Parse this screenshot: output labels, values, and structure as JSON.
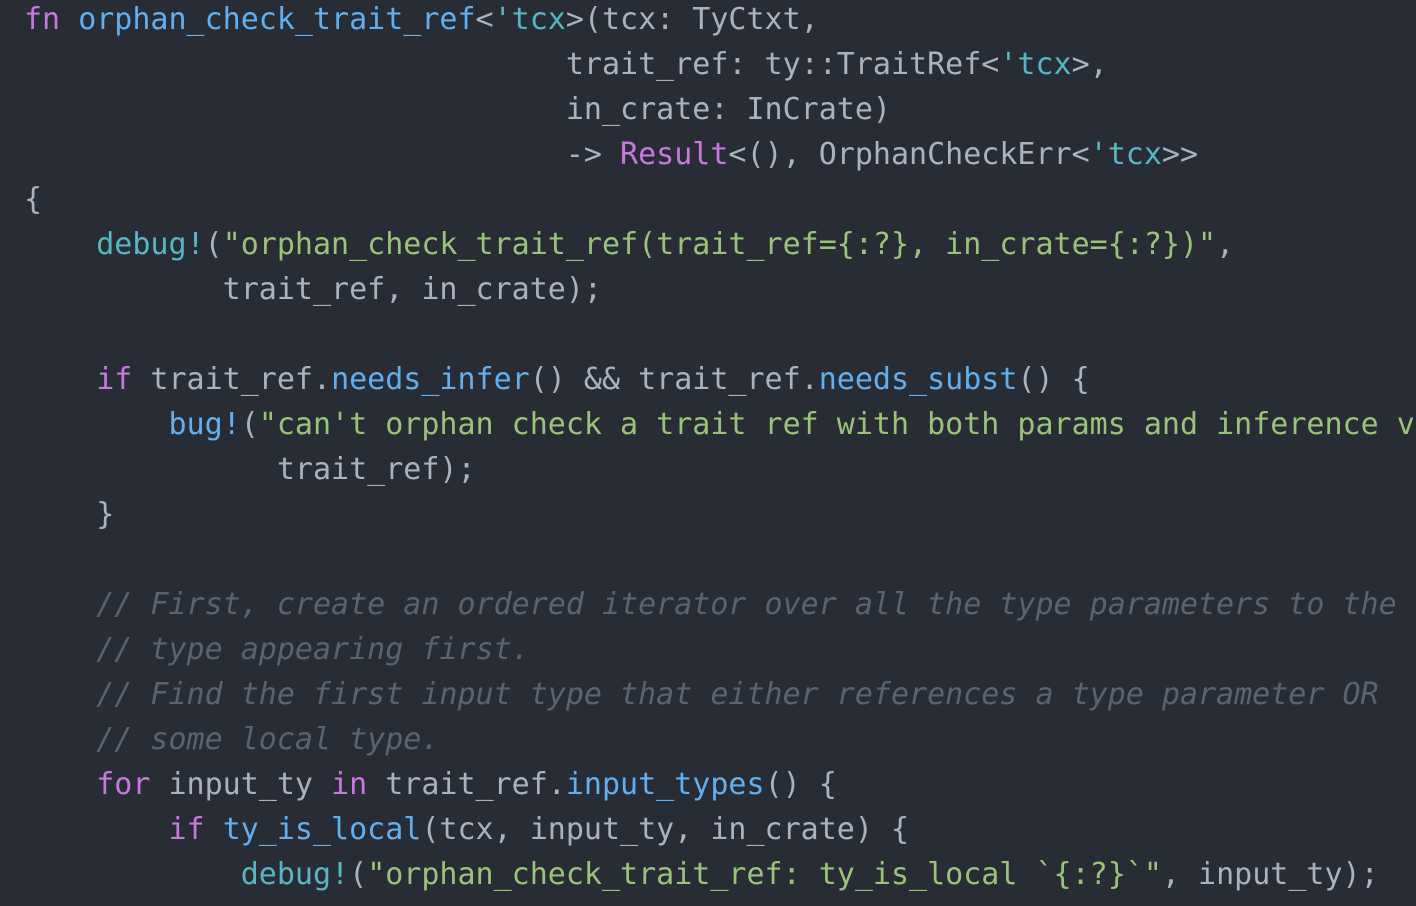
{
  "editor": {
    "background": "#282c34",
    "colors": {
      "keyword": "#c678dd",
      "function": "#61afef",
      "lifetime": "#56b6c2",
      "string": "#98c379",
      "comment": "#5c6370",
      "macro": "#56b6c2",
      "plain": "#abb2bf"
    },
    "lines": [
      [
        {
          "t": "fn",
          "c": "kw"
        },
        {
          "t": " ",
          "c": "plain"
        },
        {
          "t": "orphan_check_trait_ref",
          "c": "fn"
        },
        {
          "t": "<",
          "c": "plain"
        },
        {
          "t": "'tcx",
          "c": "lt"
        },
        {
          "t": ">(tcx: TyCtxt,",
          "c": "plain"
        }
      ],
      [
        {
          "t": "                              trait_ref: ty::TraitRef<",
          "c": "plain"
        },
        {
          "t": "'tcx",
          "c": "lt"
        },
        {
          "t": ">,",
          "c": "plain"
        }
      ],
      [
        {
          "t": "                              in_crate: InCrate)",
          "c": "plain"
        }
      ],
      [
        {
          "t": "                              -> ",
          "c": "plain"
        },
        {
          "t": "Result",
          "c": "result"
        },
        {
          "t": "<(), OrphanCheckErr<",
          "c": "plain"
        },
        {
          "t": "'tcx",
          "c": "lt"
        },
        {
          "t": ">>",
          "c": "plain"
        }
      ],
      [
        {
          "t": "{",
          "c": "plain"
        }
      ],
      [
        {
          "t": "    ",
          "c": "plain"
        },
        {
          "t": "debug!",
          "c": "macro"
        },
        {
          "t": "(",
          "c": "plain"
        },
        {
          "t": "\"orphan_check_trait_ref(trait_ref={:?}, in_crate={:?})\"",
          "c": "str"
        },
        {
          "t": ",",
          "c": "plain"
        }
      ],
      [
        {
          "t": "           trait_ref, in_crate);",
          "c": "plain"
        }
      ],
      [],
      [
        {
          "t": "    ",
          "c": "plain"
        },
        {
          "t": "if",
          "c": "kw"
        },
        {
          "t": " trait_ref.",
          "c": "plain"
        },
        {
          "t": "needs_infer",
          "c": "fn"
        },
        {
          "t": "() && trait_ref.",
          "c": "plain"
        },
        {
          "t": "needs_subst",
          "c": "fn"
        },
        {
          "t": "() {",
          "c": "plain"
        }
      ],
      [
        {
          "t": "        ",
          "c": "plain"
        },
        {
          "t": "bug!",
          "c": "fn"
        },
        {
          "t": "(",
          "c": "plain"
        },
        {
          "t": "\"can't orphan check a trait ref with both params and inference va",
          "c": "str"
        }
      ],
      [
        {
          "t": "              trait_ref);",
          "c": "plain"
        }
      ],
      [
        {
          "t": "    }",
          "c": "plain"
        }
      ],
      [],
      [
        {
          "t": "    // First, create an ordered iterator over all the type parameters to the",
          "c": "cmt"
        }
      ],
      [
        {
          "t": "    // type appearing first.",
          "c": "cmt"
        }
      ],
      [
        {
          "t": "    // Find the first input type that either references a type parameter OR",
          "c": "cmt"
        }
      ],
      [
        {
          "t": "    // some local type.",
          "c": "cmt"
        }
      ],
      [
        {
          "t": "    ",
          "c": "plain"
        },
        {
          "t": "for",
          "c": "kw"
        },
        {
          "t": " input_ty ",
          "c": "plain"
        },
        {
          "t": "in",
          "c": "kw"
        },
        {
          "t": " trait_ref.",
          "c": "plain"
        },
        {
          "t": "input_types",
          "c": "fn"
        },
        {
          "t": "() {",
          "c": "plain"
        }
      ],
      [
        {
          "t": "        ",
          "c": "plain"
        },
        {
          "t": "if",
          "c": "kw"
        },
        {
          "t": " ",
          "c": "plain"
        },
        {
          "t": "ty_is_local",
          "c": "fn"
        },
        {
          "t": "(tcx, input_ty, in_crate) {",
          "c": "plain"
        }
      ],
      [
        {
          "t": "            ",
          "c": "plain"
        },
        {
          "t": "debug!",
          "c": "macro"
        },
        {
          "t": "(",
          "c": "plain"
        },
        {
          "t": "\"orphan_check_trait_ref: ty_is_local `{:?}`\"",
          "c": "str"
        },
        {
          "t": ", input_ty);",
          "c": "plain"
        }
      ]
    ]
  }
}
